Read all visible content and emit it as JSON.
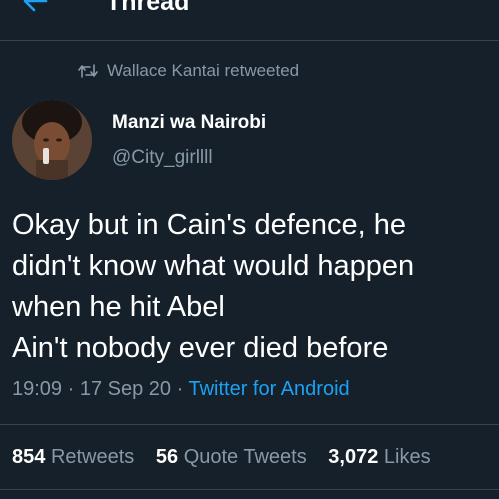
{
  "header": {
    "title": "Thread",
    "back_icon": "arrow-left-icon"
  },
  "colors": {
    "background": "#15202b",
    "accent": "#1da1f2",
    "secondary_text": "#8899a6",
    "divider": "#38444d"
  },
  "retweet_context": {
    "icon": "retweet-icon",
    "text": "Wallace Kantai retweeted"
  },
  "author": {
    "display_name": "Manzi wa Nairobi",
    "username": "@City_girllll"
  },
  "tweet": {
    "lines": [
      "Okay but in Cain's defence, he",
      "didn't know what would happen",
      "when he hit Abel",
      "Ain't nobody ever died before"
    ],
    "time": "19:09",
    "date": "17 Sep 20",
    "source": "Twitter for Android"
  },
  "stats": {
    "retweets_count": "854",
    "retweets_label": "Retweets",
    "quotes_count": "56",
    "quotes_label": "Quote Tweets",
    "likes_count": "3,072",
    "likes_label": "Likes"
  }
}
